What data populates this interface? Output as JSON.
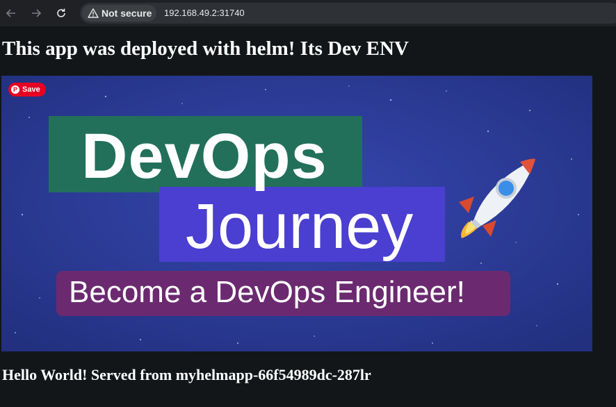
{
  "browser": {
    "security_label": "Not secure",
    "url": "192.168.49.2:31740"
  },
  "page": {
    "heading": "This app was deployed with helm! Its Dev ENV",
    "banner": {
      "save_label": "Save",
      "line1": "DevOps",
      "line2": "Journey",
      "line3": "Become a DevOps Engineer!"
    },
    "footer": "Hello World! Served from myhelmapp-66f54989dc-287lr"
  }
}
